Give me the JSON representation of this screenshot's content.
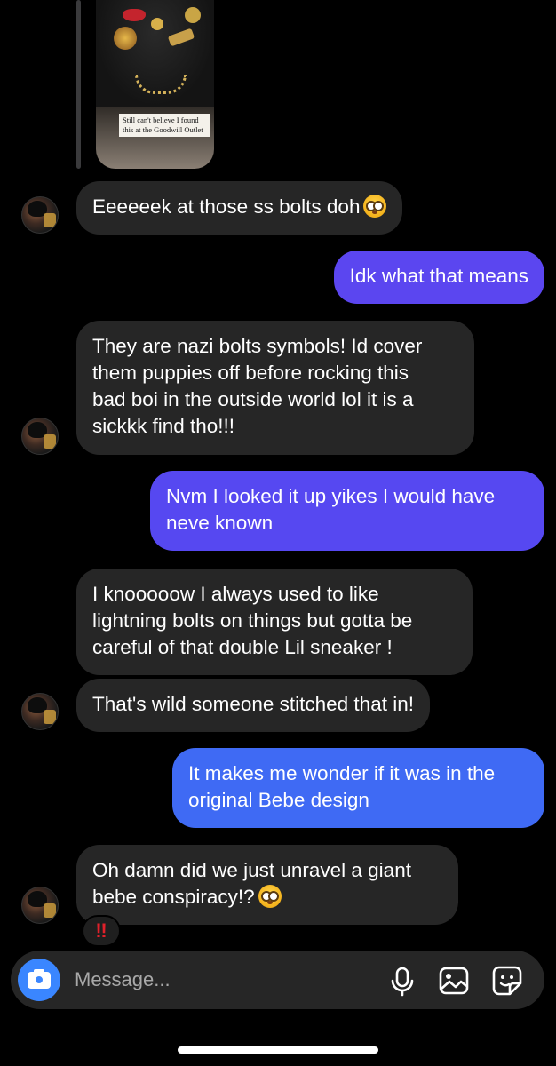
{
  "shared_story": {
    "caption": "Still can't believe I found this at the Goodwill Outlet"
  },
  "messages": [
    {
      "dir": "in",
      "text": "Eeeeeek at those ss bolts doh",
      "emoji": "flushed-face"
    },
    {
      "dir": "out",
      "text": "Idk what that means"
    },
    {
      "dir": "in",
      "lines": [
        "They are nazi bolts symbols! Id cover",
        "them puppies off before rocking this",
        "bad boi in the outside world lol it is a",
        "sickkk find tho!!!"
      ]
    },
    {
      "dir": "out",
      "lines": [
        "Nvm I looked it up yikes I would have",
        "neve known"
      ]
    },
    {
      "dir": "in",
      "lines": [
        "I knooooow I always used to like",
        "lightning bolts on things but gotta be",
        "careful of that double Lil sneaker !"
      ]
    },
    {
      "dir": "in",
      "text": "That's wild someone stitched that in!"
    },
    {
      "dir": "out",
      "lines": [
        "It makes me wonder if it was in the",
        "original Bebe design"
      ]
    },
    {
      "dir": "in",
      "lines": [
        "Oh damn did we just unravel a giant",
        "bebe conspiracy!?"
      ],
      "emoji": "flushed-face"
    }
  ],
  "reaction": {
    "symbol": "‼"
  },
  "composer": {
    "placeholder": "Message...",
    "icons": [
      "camera-icon",
      "microphone-icon",
      "gallery-icon",
      "sticker-icon"
    ]
  },
  "colors": {
    "background": "#000000",
    "incoming_bubble": "#262626",
    "outgoing_gradient_top": "#6a3cf0",
    "outgoing_gradient_bottom": "#3b6ef5",
    "accent": "#3a86ff"
  }
}
